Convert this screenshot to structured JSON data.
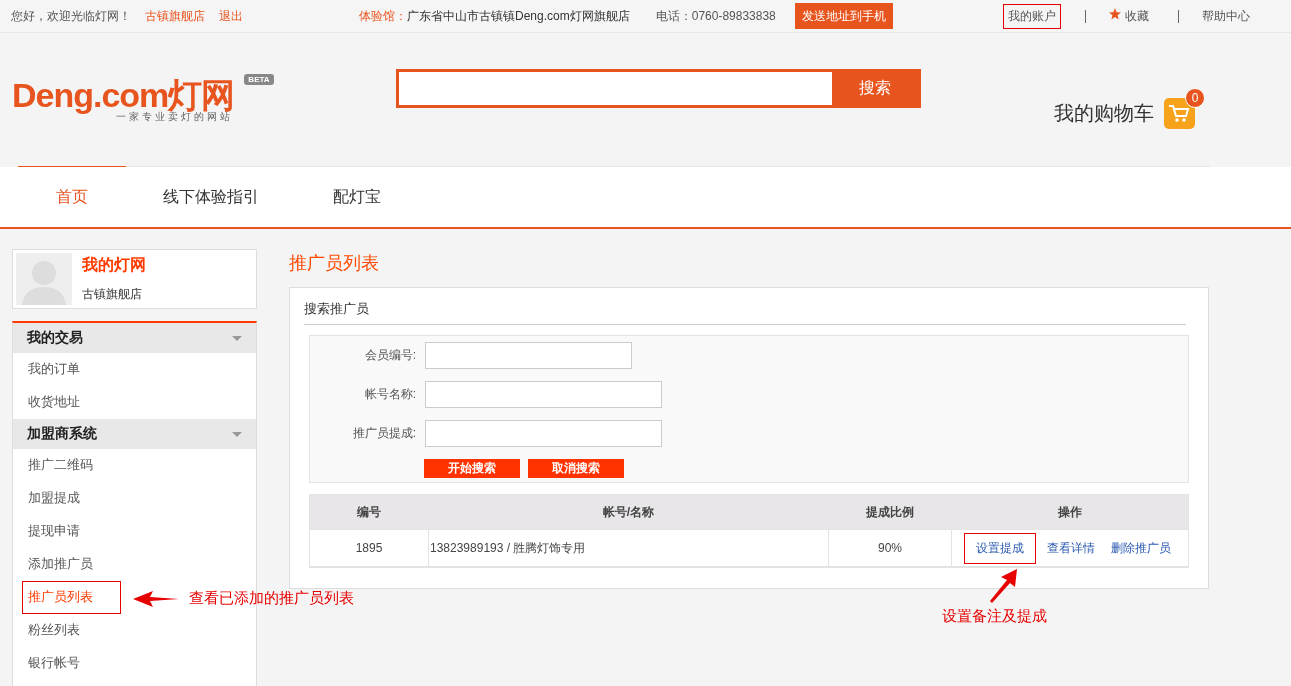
{
  "top_bar": {
    "greeting": "您好，欢迎光临灯网！",
    "store_link": "古镇旗舰店",
    "logout": "退出",
    "showroom_label": "体验馆：",
    "showroom_address": "广东省中山市古镇镇Deng.com灯网旗舰店",
    "phone": "电话：0760-89833838",
    "send_button": "发送地址到手机",
    "links": [
      {
        "label": "我的账户",
        "highlighted": true,
        "kind": "plain"
      },
      {
        "label": "收藏",
        "highlighted": false,
        "kind": "star"
      },
      {
        "label": "帮助中心",
        "highlighted": false,
        "kind": "plain"
      }
    ]
  },
  "header": {
    "logo": {
      "wordmark": "Deng.com灯网",
      "tagline": "一家专业卖灯的网站",
      "badge": "BETA"
    },
    "search_button": "搜索",
    "cart": {
      "label": "我的购物车",
      "count": "0"
    }
  },
  "nav": [
    {
      "label": "首页",
      "selected": true
    },
    {
      "label": "线下体验指引",
      "selected": false
    },
    {
      "label": "配灯宝",
      "selected": false
    }
  ],
  "sidebar": {
    "profile": {
      "name": "我的灯网",
      "store": "古镇旗舰店"
    },
    "groups": [
      {
        "title": "我的交易",
        "expanded": true,
        "items": [
          {
            "label": "我的订单",
            "selected": false,
            "highlighted": false
          },
          {
            "label": "收货地址",
            "selected": false,
            "highlighted": false
          }
        ]
      },
      {
        "title": "加盟商系统",
        "expanded": true,
        "items": [
          {
            "label": "推广二维码",
            "selected": false,
            "highlighted": false
          },
          {
            "label": "加盟提成",
            "selected": false,
            "highlighted": false
          },
          {
            "label": "提现申请",
            "selected": false,
            "highlighted": false
          },
          {
            "label": "添加推广员",
            "selected": false,
            "highlighted": false
          },
          {
            "label": "推广员列表",
            "selected": true,
            "highlighted": true,
            "note": "查看已添加的推广员列表"
          },
          {
            "label": "粉丝列表",
            "selected": false,
            "highlighted": false
          },
          {
            "label": "银行帐号",
            "selected": false,
            "highlighted": false
          }
        ]
      }
    ]
  },
  "main": {
    "title": "推广员列表",
    "search_panel": {
      "title": "搜索推广员",
      "fields": [
        {
          "label": "会员编号:"
        },
        {
          "label": "帐号名称:"
        },
        {
          "label": "推广员提成:"
        }
      ],
      "buttons": [
        "开始搜索",
        "取消搜索"
      ]
    },
    "table": {
      "columns": [
        "编号",
        "帐号/名称",
        "提成比例",
        "操作"
      ],
      "rows": [
        {
          "cells": [
            "1895",
            "13823989193 / 胜腾灯饰专用",
            "90%"
          ],
          "actions": [
            {
              "label": "设置提成",
              "highlighted": true,
              "note": "设置备注及提成"
            },
            {
              "label": "查看详情",
              "highlighted": false
            },
            {
              "label": "删除推广员",
              "highlighted": false
            }
          ]
        }
      ]
    }
  }
}
